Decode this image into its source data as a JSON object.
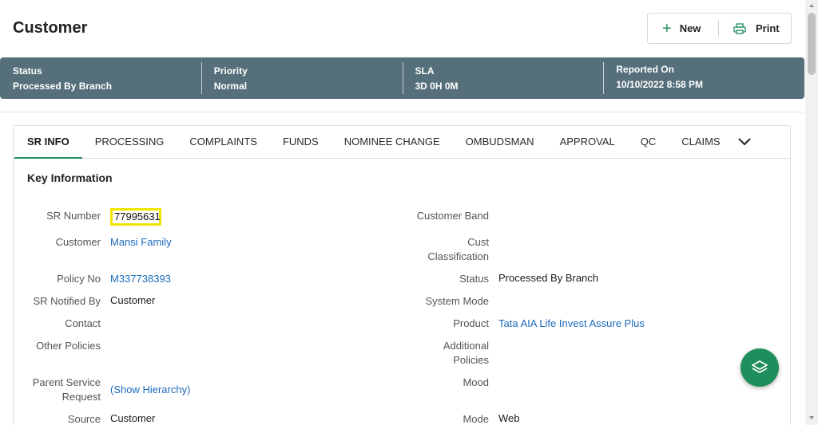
{
  "header": {
    "title": "Customer",
    "new_label": "New",
    "print_label": "Print"
  },
  "banner": [
    {
      "label": "Status",
      "value": "Processed By Branch"
    },
    {
      "label": "Priority",
      "value": "Normal"
    },
    {
      "label": "SLA",
      "value": "3D 0H 0M"
    },
    {
      "label": "Reported On",
      "value": "10/10/2022 8:58 PM"
    }
  ],
  "tabs": [
    "SR INFO",
    "PROCESSING",
    "COMPLAINTS",
    "FUNDS",
    "NOMINEE CHANGE",
    "OMBUDSMAN",
    "APPROVAL",
    "QC",
    "CLAIMS"
  ],
  "active_tab": "SR INFO",
  "key_info": {
    "title": "Key Information",
    "left": {
      "sr_number": {
        "label": "SR Number",
        "value": "77995631"
      },
      "customer": {
        "label": "Customer",
        "value": "Mansi Family"
      },
      "policy_no": {
        "label": "Policy No",
        "value": "M337738393"
      },
      "sr_notified_by": {
        "label": "SR Notified By",
        "value": "Customer"
      },
      "contact": {
        "label": "Contact",
        "value": ""
      },
      "other_policies": {
        "label": "Other Policies",
        "value": ""
      },
      "parent_service_request": {
        "label_line1": "Parent Service",
        "label_line2": "Request",
        "value": "(Show Hierarchy)"
      },
      "source": {
        "label": "Source",
        "value": "Customer"
      }
    },
    "right": {
      "customer_band": {
        "label": "Customer Band",
        "value": ""
      },
      "cust_classification": {
        "label_line1": "Cust",
        "label_line2": "Classification",
        "value": ""
      },
      "status": {
        "label": "Status",
        "value": "Processed By Branch"
      },
      "system_mode": {
        "label": "System Mode",
        "value": ""
      },
      "product": {
        "label": "Product",
        "value": "Tata AIA Life Invest Assure Plus"
      },
      "additional_policies": {
        "label_line1": "Additional",
        "label_line2": "Policies",
        "value": ""
      },
      "mood": {
        "label": "Mood",
        "value": ""
      },
      "mode": {
        "label": "Mode",
        "value": "Web"
      }
    }
  },
  "colors": {
    "accent": "#1e8e5c",
    "banner": "#56707b",
    "link": "#1c6bbd",
    "highlight": "#f2e600"
  },
  "icons": {
    "new": "plus-icon",
    "print": "printer-icon",
    "fab": "layers-icon",
    "more_tabs": "chevron-down-icon"
  }
}
